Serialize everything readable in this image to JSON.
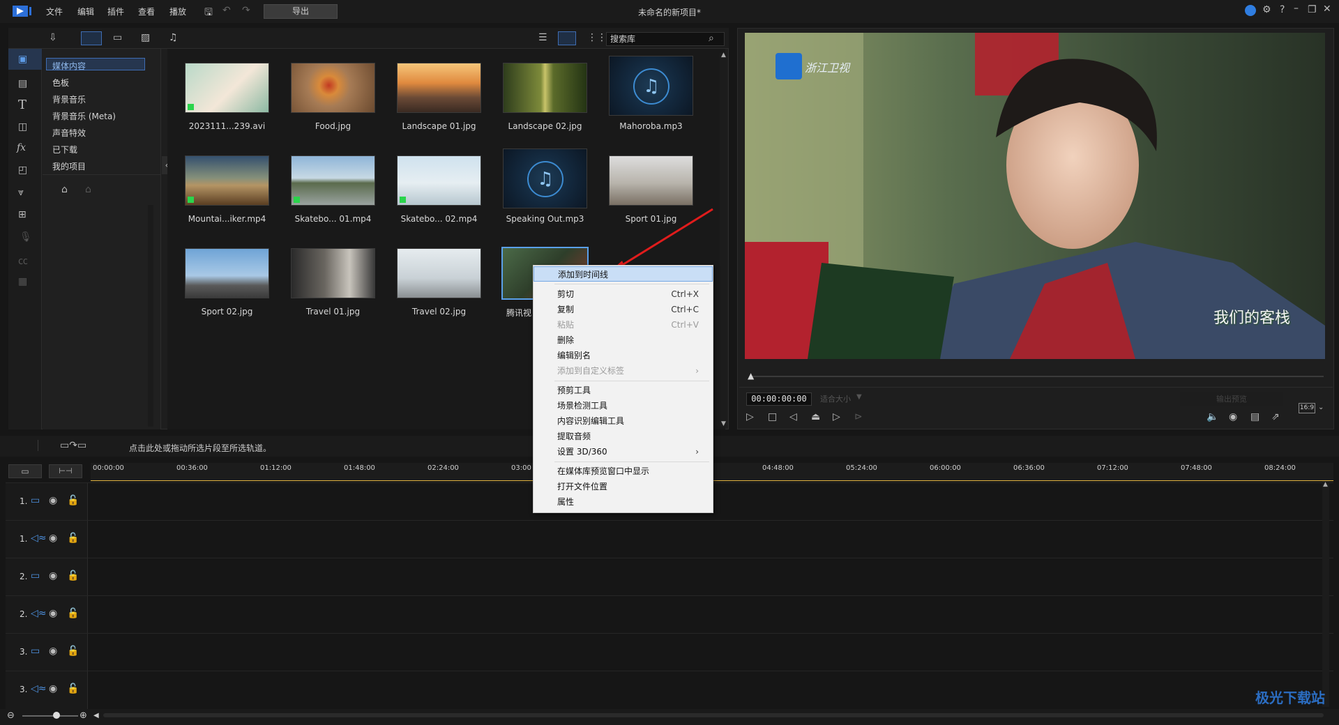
{
  "app": {
    "title": "未命名的新项目*",
    "menu": [
      "文件",
      "编辑",
      "插件",
      "查看",
      "播放"
    ],
    "export_label": "导出",
    "window_controls": [
      "help-icon",
      "settings-icon",
      "minimize-icon",
      "restore-icon",
      "close-icon"
    ]
  },
  "library": {
    "tree": [
      "媒体内容",
      "色板",
      "背景音乐",
      "背景音乐 (Meta)",
      "声音特效",
      "已下载",
      "我的项目"
    ],
    "search_placeholder": "搜索库",
    "items": [
      {
        "name": "2023111...239.avi",
        "kind": "video"
      },
      {
        "name": "Food.jpg",
        "kind": "image"
      },
      {
        "name": "Landscape 01.jpg",
        "kind": "image"
      },
      {
        "name": "Landscape 02.jpg",
        "kind": "image"
      },
      {
        "name": "Mahoroba.mp3",
        "kind": "audio"
      },
      {
        "name": "Mountai...iker.mp4",
        "kind": "video"
      },
      {
        "name": "Skatebo... 01.mp4",
        "kind": "video"
      },
      {
        "name": "Skatebo... 02.mp4",
        "kind": "video"
      },
      {
        "name": "Speaking Out.mp3",
        "kind": "audio"
      },
      {
        "name": "Sport 01.jpg",
        "kind": "image"
      },
      {
        "name": "Sport 02.jpg",
        "kind": "image"
      },
      {
        "name": "Travel 01.jpg",
        "kind": "image"
      },
      {
        "name": "Travel 02.jpg",
        "kind": "image"
      },
      {
        "name": "腾讯视",
        "kind": "video"
      }
    ]
  },
  "preview": {
    "channel_logo": "浙江卫视",
    "watermark": "我们的客栈",
    "timecode": "00:00:00:00",
    "fit_label": "适合大小",
    "output_label": "输出预览",
    "aspect": "16:9"
  },
  "timeline": {
    "hint": "点击此处或拖动所选片段至所选轨道。",
    "ruler": [
      "00:00:00",
      "00:36:00",
      "01:12:00",
      "01:48:00",
      "02:24:00",
      "03:00",
      "04:48:00",
      "05:24:00",
      "06:00:00",
      "06:36:00",
      "07:12:00",
      "07:48:00",
      "08:24:00"
    ],
    "tracks": [
      "1.",
      "1.",
      "2.",
      "2.",
      "3.",
      "3."
    ]
  },
  "context_menu": {
    "items": [
      {
        "label": "添加到时间线",
        "shortcut": "",
        "state": "highlighted"
      },
      {
        "label": "剪切",
        "shortcut": "Ctrl+X",
        "state": "normal"
      },
      {
        "label": "复制",
        "shortcut": "Ctrl+C",
        "state": "normal"
      },
      {
        "label": "粘贴",
        "shortcut": "Ctrl+V",
        "state": "disabled"
      },
      {
        "label": "删除",
        "shortcut": "",
        "state": "normal"
      },
      {
        "label": "编辑别名",
        "shortcut": "",
        "state": "normal"
      },
      {
        "label": "添加到自定义标签",
        "shortcut": "›",
        "state": "disabled"
      },
      {
        "label": "预剪工具",
        "shortcut": "",
        "state": "normal"
      },
      {
        "label": "场景检测工具",
        "shortcut": "",
        "state": "normal"
      },
      {
        "label": "内容识别编辑工具",
        "shortcut": "",
        "state": "normal"
      },
      {
        "label": "提取音频",
        "shortcut": "",
        "state": "normal"
      },
      {
        "label": "设置 3D/360",
        "shortcut": "›",
        "state": "normal"
      },
      {
        "label": "在媒体库预览窗口中显示",
        "shortcut": "",
        "state": "normal"
      },
      {
        "label": "打开文件位置",
        "shortcut": "",
        "state": "normal"
      },
      {
        "label": "属性",
        "shortcut": "",
        "state": "normal"
      }
    ]
  },
  "watermark_site": "极光下载站"
}
